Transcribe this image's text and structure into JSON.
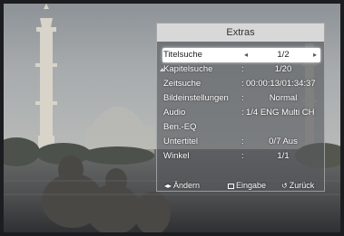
{
  "menu": {
    "title": "Extras",
    "items": [
      {
        "label": "Titelsuche",
        "sep": "",
        "value": "1/2",
        "selected": true
      },
      {
        "label": "Kapitelsuche",
        "sep": ":",
        "value": "1/20"
      },
      {
        "label": "Zeitsuche",
        "sep": ":",
        "value": "00:00:13/01:34:37"
      },
      {
        "label": "Bildeinstellungen",
        "sep": ":",
        "value": "Normal"
      },
      {
        "label": "Audio",
        "sep": ":",
        "value": "1/4 ENG Multi CH"
      },
      {
        "label": "Ben.-EQ",
        "sep": "",
        "value": ""
      },
      {
        "label": "Untertitel",
        "sep": ":",
        "value": "0/7 Aus"
      },
      {
        "label": "Winkel",
        "sep": ":",
        "value": "1/1"
      }
    ],
    "footer": {
      "change_glyph": "◂▸",
      "change_label": "Ändern",
      "enter_label": "Eingabe",
      "back_glyph": "↺",
      "back_label": "Zurück"
    }
  },
  "colors": {
    "panel_bg": "#56585c",
    "title_bar": "#e1e1e1",
    "selection": "#ffffff"
  }
}
